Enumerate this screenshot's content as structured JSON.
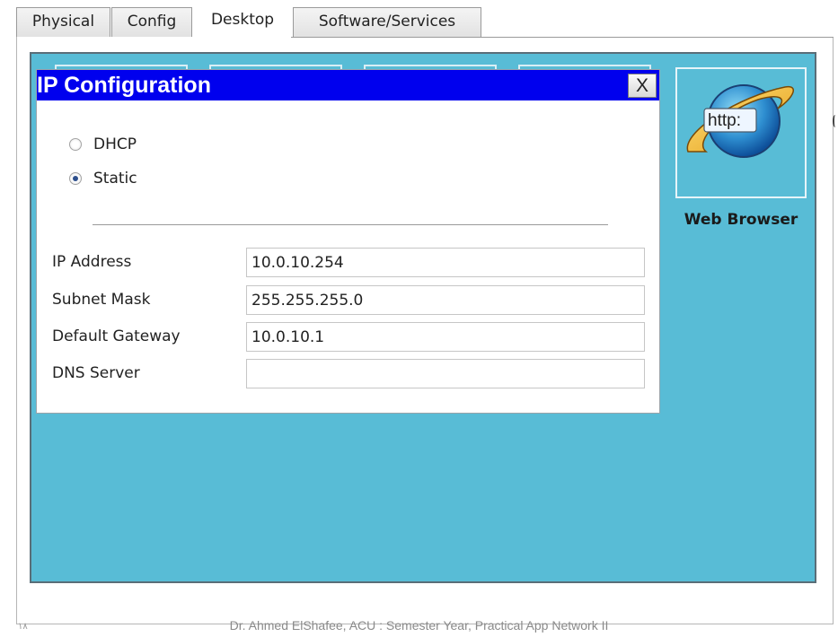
{
  "tabs": [
    {
      "label": "Physical",
      "active": false
    },
    {
      "label": "Config",
      "active": false
    },
    {
      "label": "Desktop",
      "active": true
    },
    {
      "label": "Software/Services",
      "active": false
    }
  ],
  "desktop": {
    "background_color": "#58bcd6",
    "apps": [
      {
        "label": "Web Browser",
        "icon": "web-browser-icon",
        "icon_text": "http:"
      }
    ]
  },
  "dialog": {
    "title": "IP Configuration",
    "titlebar_color": "#0000ee",
    "close_label": "X",
    "mode_options": [
      {
        "label": "DHCP",
        "selected": false
      },
      {
        "label": "Static",
        "selected": true
      }
    ],
    "fields": [
      {
        "label": "IP Address",
        "value": "10.0.10.254"
      },
      {
        "label": "Subnet Mask",
        "value": "255.255.255.0"
      },
      {
        "label": "Default Gateway",
        "value": "10.0.10.1"
      },
      {
        "label": "DNS Server",
        "value": ""
      }
    ]
  },
  "footer": {
    "page_number": "١٨",
    "text": "Dr. Ahmed ElShafee, ACU : Semester Year, Practical App Network II"
  }
}
